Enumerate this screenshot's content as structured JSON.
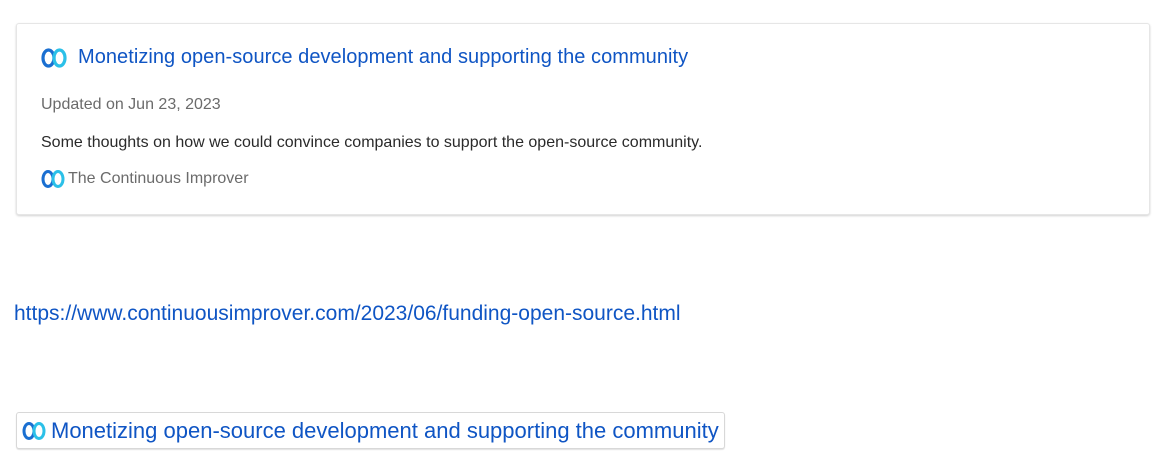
{
  "link_card": {
    "title": "Monetizing open-source development and supporting the community",
    "updated": "Updated on Jun 23, 2023",
    "description": "Some thoughts on how we could convince companies to support the open-source community.",
    "source_name": "The Continuous Improver",
    "logo_icon": "infinity-logo-icon"
  },
  "plain_link": {
    "url": "https://www.continuousimprover.com/2023/06/funding-open-source.html"
  },
  "link_chip": {
    "title": "Monetizing open-source development and supporting the community",
    "logo_icon": "infinity-logo-icon"
  },
  "colors": {
    "link": "#0f55c4",
    "logo_dark": "#1a6fd1",
    "logo_light": "#2bc0e8",
    "muted_text": "#6b6b6b",
    "body_text": "#2a2a2a"
  }
}
